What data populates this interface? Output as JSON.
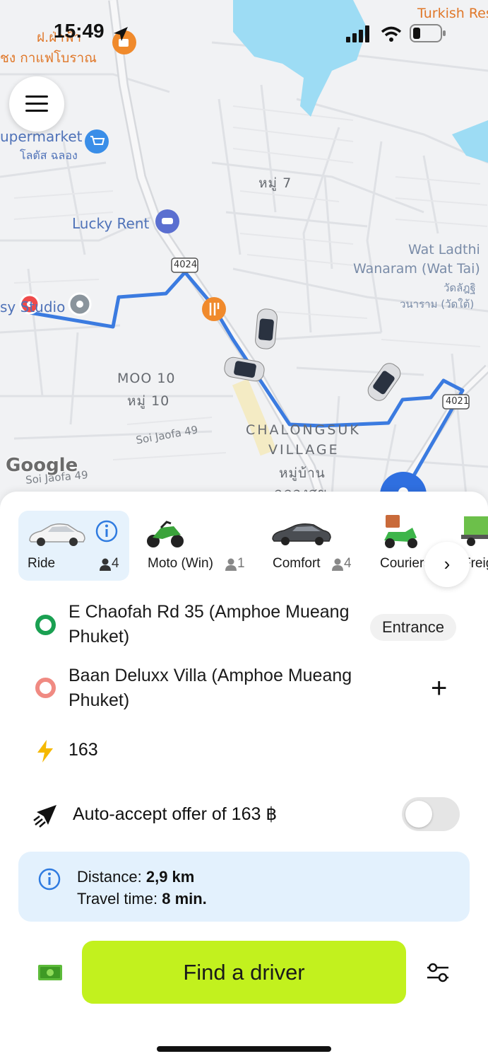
{
  "status_bar": {
    "time": "15:49",
    "cellular_icon": "signal-bars-icon",
    "wifi_icon": "wifi-icon",
    "battery_icon": "battery-low-icon"
  },
  "map": {
    "labels": {
      "turkish": "Turkish Res",
      "thai_top": "ฝ.ฝ่าฟ้า",
      "thai_cafe": "ชง กาแฟโบราณ",
      "supermarket": "upermarket",
      "supermarket_thai": "โลตัส ฉลอง",
      "moo7": "หมู่ 7",
      "lucky_rent": "Lucky Rent",
      "road_4024": "4024",
      "wat1": "Wat Ladthi",
      "wat2": "Wanaram (Wat Tai)",
      "wat_thai1": "วัดลัฎฐิ",
      "wat_thai2": "วนาราม (วัดใต้)",
      "studio": "sy Studio",
      "moo10": "MOO 10",
      "moo10_thai": "หมู่ 10",
      "soi_jaofa": "Soi Jaofa 49",
      "soi_jaofa2": "Soi Jaofa 49",
      "chalongsuk1": "CHALONGSUK",
      "chalongsuk2": "VILLAGE",
      "chalongsuk_thai1": "หมู่บ้าน",
      "chalongsuk_thai2": "ฉลองสุข",
      "road_4021": "4021",
      "google": "Google"
    }
  },
  "tabs": [
    {
      "label": "Ride",
      "seats": "4",
      "icon": "sedan-white-icon",
      "active": true,
      "info_icon": "info-icon"
    },
    {
      "label": "Moto (Win)",
      "seats": "1",
      "icon": "motorbike-icon",
      "active": false
    },
    {
      "label": "Comfort",
      "seats": "4",
      "icon": "sedan-dark-icon",
      "active": false
    },
    {
      "label": "Couriers",
      "seats": "",
      "icon": "scooter-courier-icon",
      "active": false
    },
    {
      "label": "Freig",
      "seats": "",
      "icon": "truck-icon",
      "active": false
    }
  ],
  "route": {
    "from": "E Chaofah Rd 35 (Amphoe Mueang Phuket)",
    "from_action": "Entrance",
    "to": "Baan Deluxx Villa (Amphoe Mueang Phuket)",
    "to_action": "+"
  },
  "price": {
    "value": "163",
    "icon": "lightning-icon"
  },
  "auto_accept": {
    "label": "Auto-accept offer of 163 ฿",
    "enabled": false,
    "icon": "paper-plane-icon"
  },
  "trip_info": {
    "distance_label": "Distance:",
    "distance_value": "2,9 km",
    "time_label": "Travel time:",
    "time_value": "8 min."
  },
  "payment_icon": "cash-icon",
  "find_button": "Find a driver",
  "settings_icon": "sliders-icon",
  "colors": {
    "accent": "#c2f11e",
    "route": "#3b7be0",
    "active_tab": "#e6f2fc",
    "info_bg": "#e3f1fd",
    "origin": "#1aa052",
    "destination": "#f08a82"
  }
}
